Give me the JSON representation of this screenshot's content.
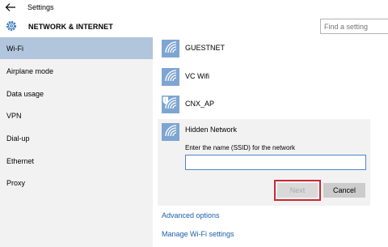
{
  "window": {
    "title": "Settings"
  },
  "header": {
    "title": "NETWORK & INTERNET",
    "search_placeholder": "Find a setting"
  },
  "sidebar": {
    "items": [
      {
        "label": "Wi-Fi",
        "selected": true
      },
      {
        "label": "Airplane mode"
      },
      {
        "label": "Data usage"
      },
      {
        "label": "VPN"
      },
      {
        "label": "Dial-up"
      },
      {
        "label": "Ethernet"
      },
      {
        "label": "Proxy"
      }
    ]
  },
  "networks": [
    {
      "name": "GUESTNET",
      "icon": "wifi-icon"
    },
    {
      "name": "VC Wifi",
      "icon": "wifi-icon"
    },
    {
      "name": "CNX_AP",
      "icon": "wifi-shield-icon"
    }
  ],
  "hidden_network": {
    "name": "Hidden Network",
    "ssid_label": "Enter the name (SSID) for the network",
    "ssid_value": "",
    "next_label": "Next",
    "cancel_label": "Cancel"
  },
  "links": {
    "advanced": "Advanced options",
    "manage": "Manage Wi-Fi settings"
  },
  "colors": {
    "selected": "#b1c6dd",
    "sidebar": "#f2f2f2",
    "icon": "#7ea5d2",
    "link": "#1a5fad",
    "highlight": "#c82b35"
  }
}
